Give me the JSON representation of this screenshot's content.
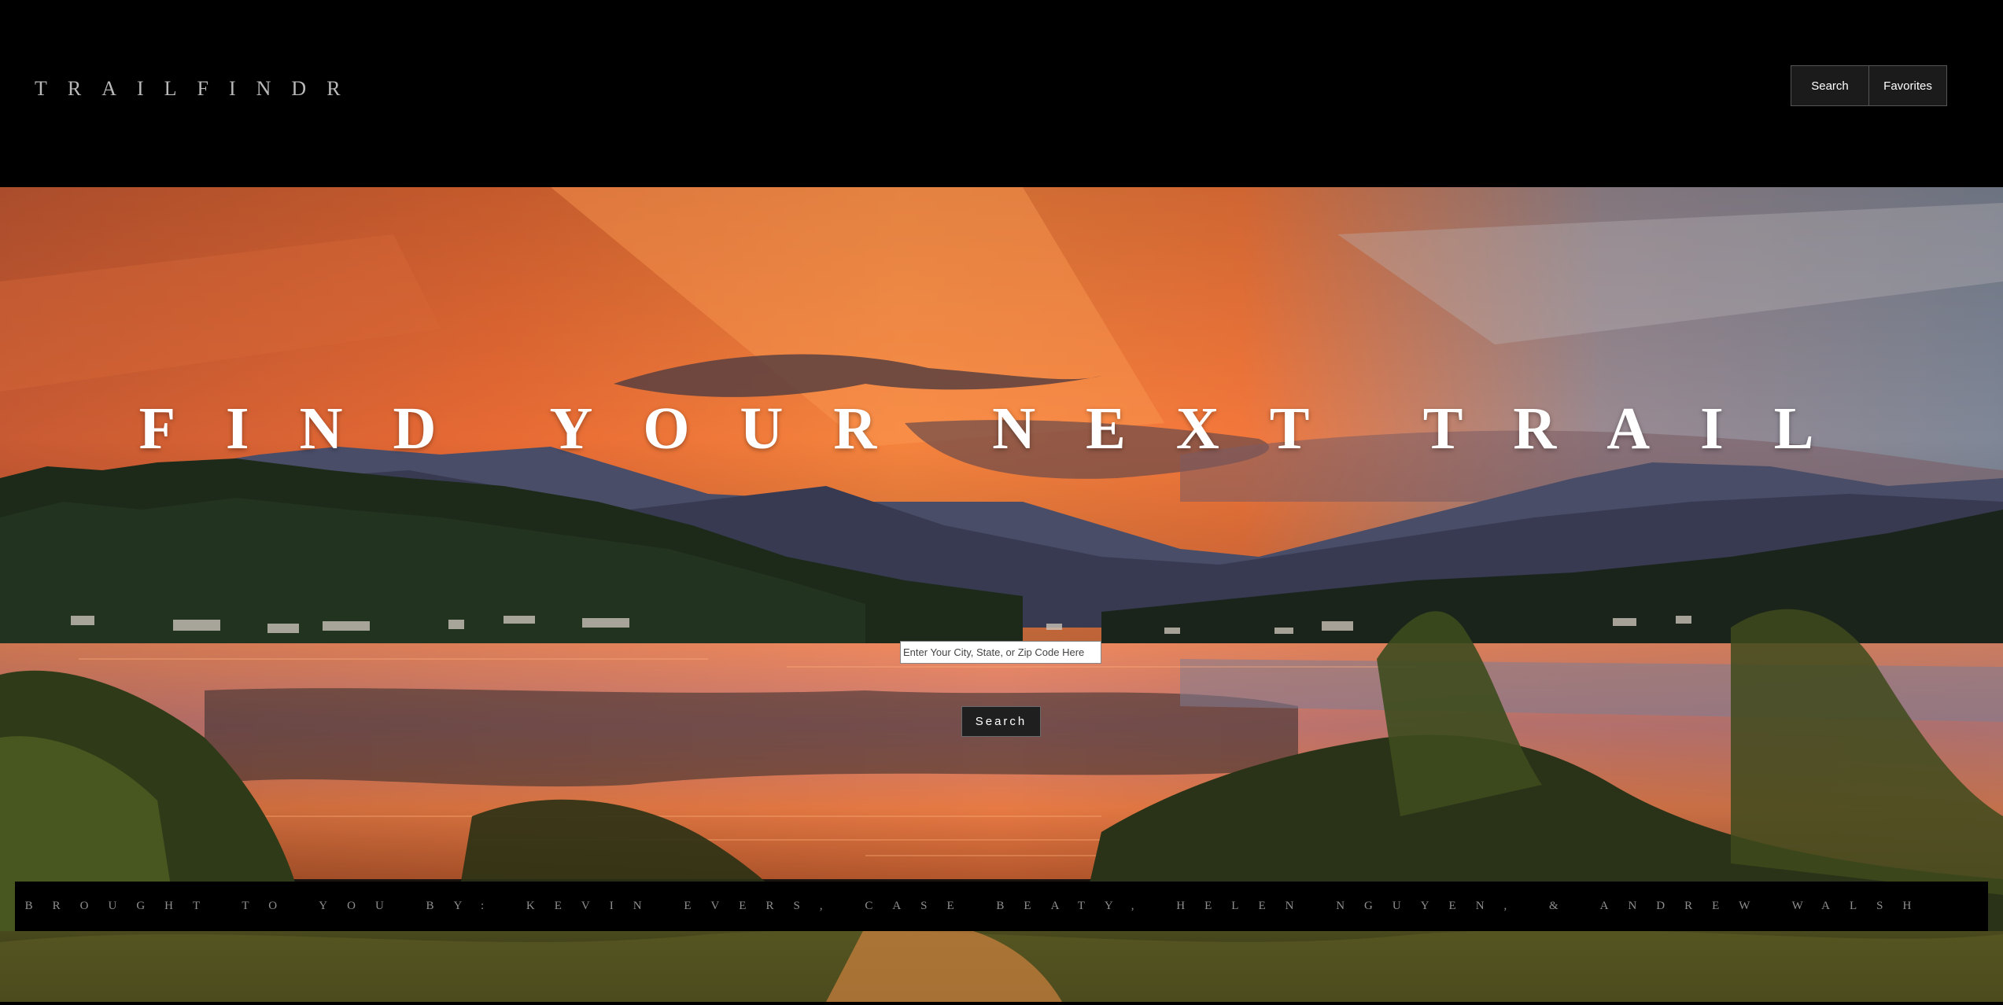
{
  "header": {
    "brand": "TRAILFINDR",
    "nav": {
      "search_label": "Search",
      "favorites_label": "Favorites"
    }
  },
  "hero": {
    "title": "FIND YOUR NEXT TRAIL",
    "search": {
      "placeholder": "Enter Your City, State, or Zip Code Here",
      "value": "",
      "button_label": "Search"
    },
    "background": "sunset-lake-mountains-photo"
  },
  "footer": {
    "credits": "BROUGHT TO YOU BY: KEVIN EVERS, CASE BEATY, HELEN NGUYEN, & ANDREW WALSH"
  },
  "colors": {
    "header_bg": "#000000",
    "button_bg": "#1b1b1b",
    "sky_orange": "#f57a3a",
    "sky_grey": "#8c8f9c",
    "text_light": "#ffffff",
    "brand_text": "#b9b9b9"
  }
}
